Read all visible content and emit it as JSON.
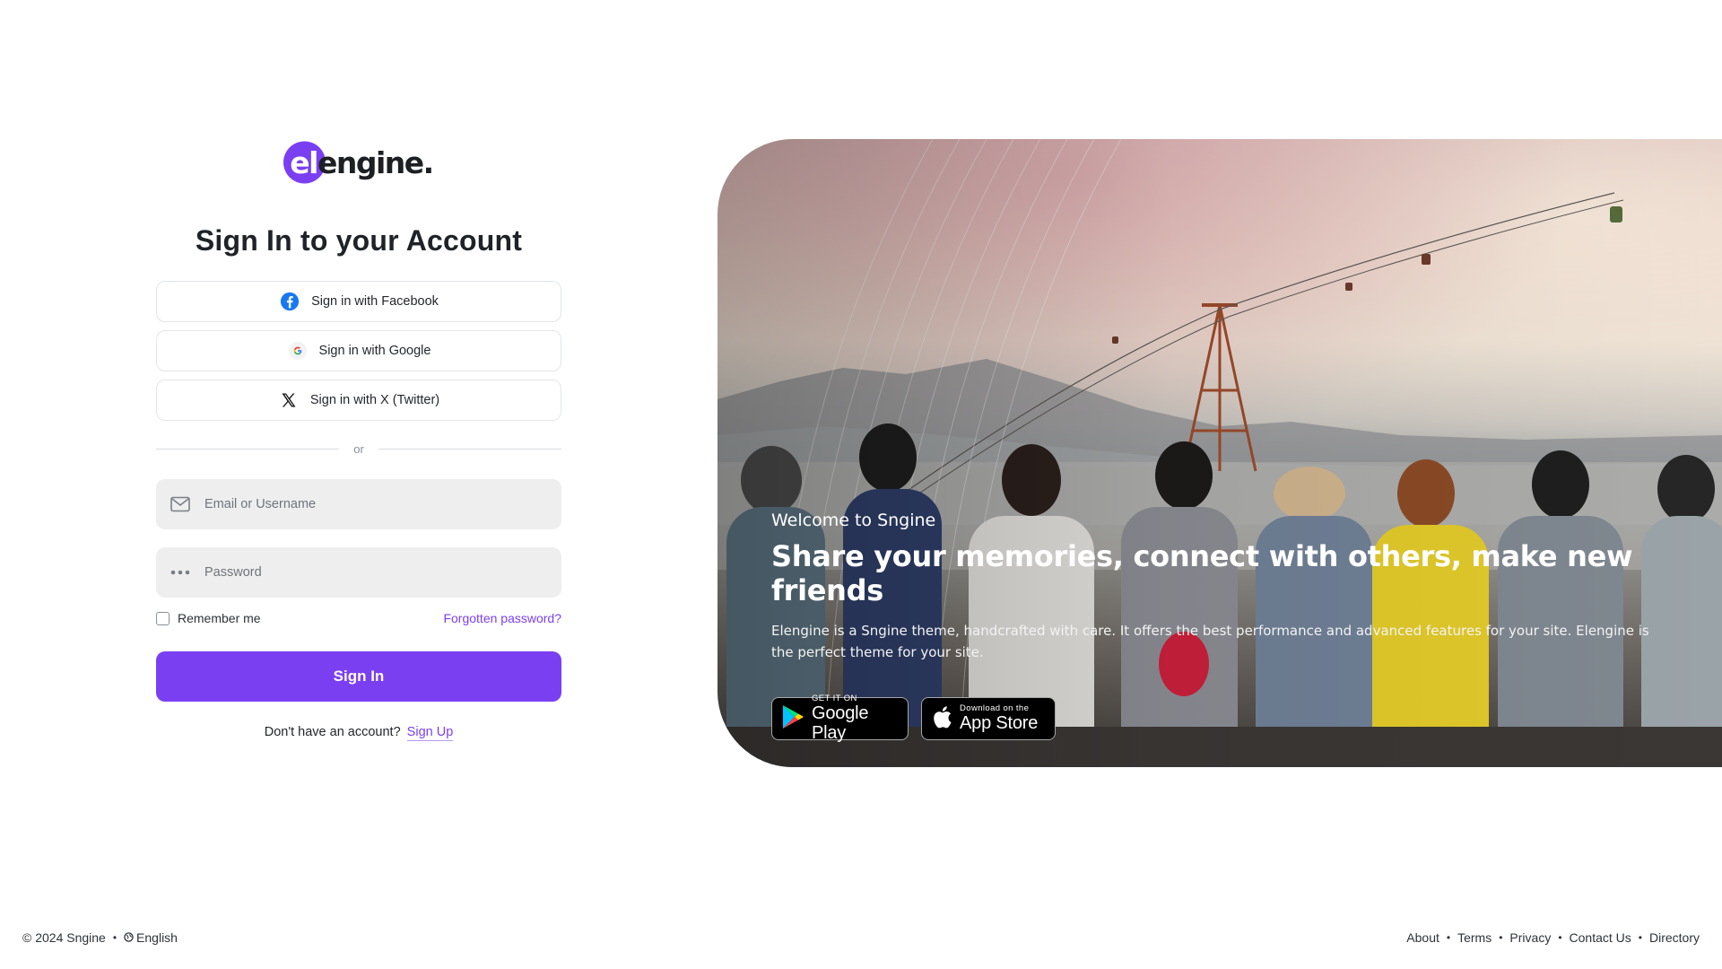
{
  "logo": {
    "mark": "el",
    "rest": "engine."
  },
  "title": "Sign In to your Account",
  "social": {
    "facebook_label": "Sign in with Facebook",
    "google_label": "Sign in with Google",
    "twitter_label": "Sign in with X (Twitter)"
  },
  "divider": "or",
  "form": {
    "email_placeholder": "Email or Username",
    "email_value": "",
    "password_placeholder": "Password",
    "password_value": "",
    "remember_label": "Remember me",
    "remember_checked": false,
    "forgot_label": "Forgotten password?",
    "signin_label": "Sign In",
    "signup_prompt": "Don't have an account?",
    "signup_label": "Sign Up"
  },
  "hero": {
    "welcome": "Welcome to Sngine",
    "headline": "Share your memories, connect with others, make new friends",
    "description": "Elengine is a Sngine theme, handcrafted with care. It offers the best performance and advanced features for your site. Elengine is the perfect theme for your site.",
    "google_play": {
      "small": "GET IT ON",
      "big": "Google Play"
    },
    "app_store": {
      "small": "Download on the",
      "big": "App Store"
    }
  },
  "footer": {
    "copyright": "© 2024 Sngine",
    "language": "English",
    "links": [
      "About",
      "Terms",
      "Privacy",
      "Contact Us",
      "Directory"
    ]
  },
  "colors": {
    "accent": "#7b3ff2",
    "input_bg": "#eeeeef",
    "border": "#e3e5e8"
  },
  "icons": {
    "email": "envelope-icon",
    "password": "dots-icon",
    "facebook": "facebook-icon",
    "google": "google-icon",
    "twitter": "x-icon",
    "globe": "globe-icon",
    "google_play": "google-play-icon",
    "app_store": "apple-icon"
  }
}
